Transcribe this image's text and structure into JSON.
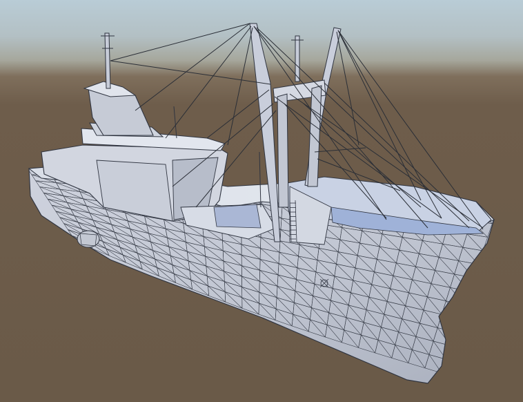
{
  "scene": {
    "hull_color": "#c3c8d3",
    "deck_color": "#dfe3ea",
    "wire_color": "#3a3f4a",
    "sky_color": "#b9ccd6",
    "ground_color": "#6e5d4b"
  }
}
